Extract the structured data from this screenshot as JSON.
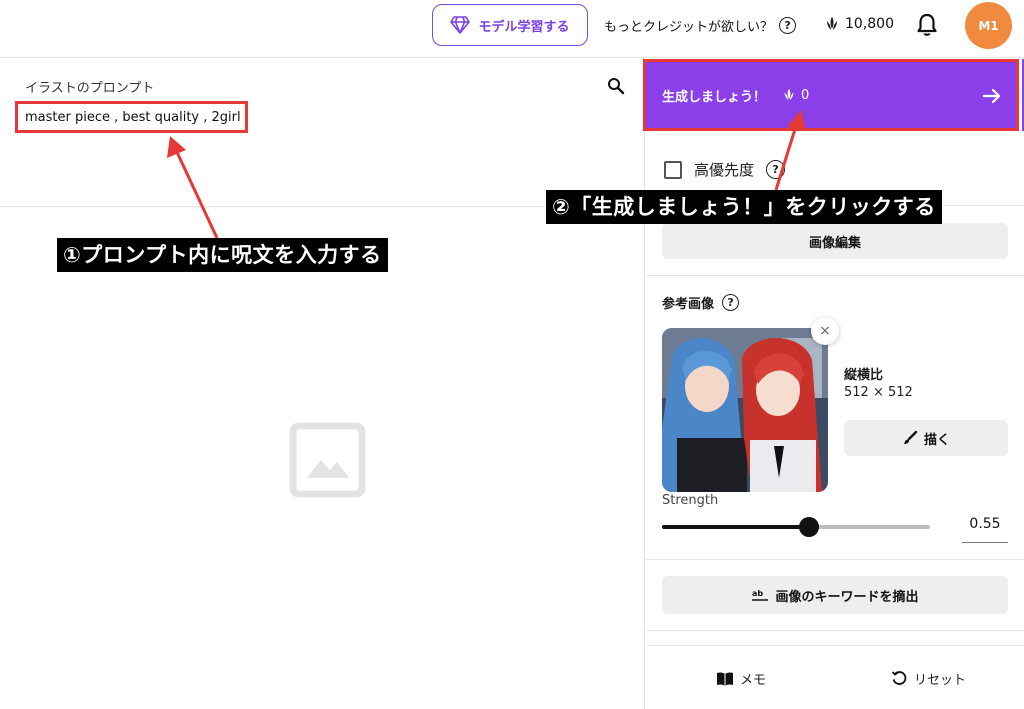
{
  "header": {
    "model_button_label": "モデル学習する",
    "credits_question": "もっとクレジットが欲しい？",
    "credit_count": "10,800",
    "avatar_initials": "M1"
  },
  "prompt": {
    "label": "イラストのプロンプト",
    "text": "master piece , best quality , 2girl"
  },
  "generate": {
    "label": "生成しましょう！",
    "cost": "0"
  },
  "options": {
    "priority_label": "高優先度",
    "edit_image_label": "画像編集"
  },
  "reference": {
    "label": "参考画像",
    "aspect_label": "縦横比",
    "aspect_value": "512 × 512",
    "draw_label": "描く",
    "strength_label": "Strength",
    "strength_value": "0.55",
    "strength_fraction": 0.55,
    "close_glyph": "×"
  },
  "keyword_button_label": "画像のキーワードを摘出",
  "bottom": {
    "memo_label": "メモ",
    "reset_label": "リセット"
  },
  "annotations": {
    "step1": "①プロンプト内に呪文を入力する",
    "step2": "②「生成しましょう！」をクリックする"
  },
  "colors": {
    "accent": "#8a3fe8",
    "highlight_border": "#e53935",
    "avatar": "#f08a3e"
  },
  "icons": [
    "diamond-icon",
    "help-icon",
    "credit-icon",
    "bell-icon",
    "search-icon",
    "image-placeholder-icon",
    "arrow-right-icon",
    "brush-icon",
    "text-extract-icon",
    "book-icon",
    "reset-icon"
  ]
}
